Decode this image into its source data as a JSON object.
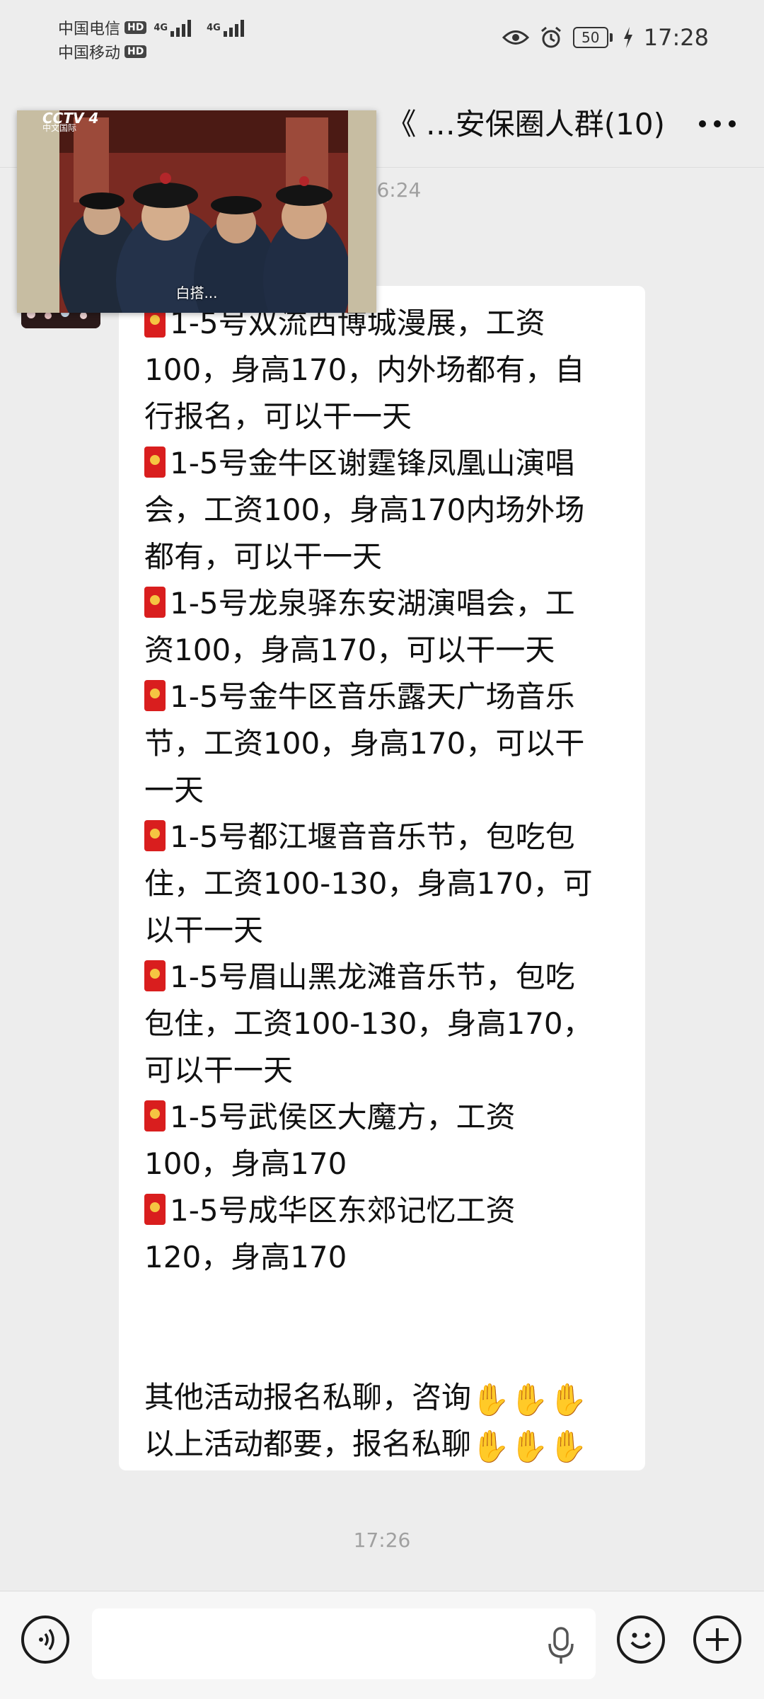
{
  "status_bar": {
    "carriers": [
      {
        "name": "中国电信",
        "badge": "HD",
        "network": "4G"
      },
      {
        "name": "中国移动",
        "badge": "HD",
        "network": "4G"
      }
    ],
    "battery": "50",
    "time": "17:28"
  },
  "header": {
    "title": "《 …安保圈人群(10)"
  },
  "floating_video": {
    "channel": "CCTV 4",
    "channel_sub": "中文国际",
    "subtitle": "白搭..."
  },
  "chat": {
    "timestamp_top": "16:24",
    "timestamp_bottom": "17:26",
    "message_lines": [
      {
        "text": "1-5号双流西博城漫展，工资",
        "redpacket": true
      },
      {
        "text": "100，身高170，内外场都有，自"
      },
      {
        "text": "行报名，可以干一天"
      },
      {
        "text": "1-5号金牛区谢霆锋凤凰山演唱",
        "redpacket": true
      },
      {
        "text": "会，工资100，身高170内场外场"
      },
      {
        "text": "都有，可以干一天"
      },
      {
        "text": "1-5号龙泉驿东安湖演唱会，工",
        "redpacket": true
      },
      {
        "text": "资100，身高170，可以干一天"
      },
      {
        "text": "1-5号金牛区音乐露天广场音乐",
        "redpacket": true
      },
      {
        "text": "节，工资100，身高170，可以干"
      },
      {
        "text": "一天"
      },
      {
        "text": "1-5号都江堰音音乐节，包吃包",
        "redpacket": true
      },
      {
        "text": "住，工资100-130，身高170，可"
      },
      {
        "text": "以干一天"
      },
      {
        "text": "1-5号眉山黑龙滩音乐节，包吃",
        "redpacket": true
      },
      {
        "text": "包住，工资100-130，身高170，"
      },
      {
        "text": "可以干一天"
      },
      {
        "text": "1-5号武侯区大魔方，工资",
        "redpacket": true
      },
      {
        "text": "100，身高170"
      },
      {
        "text": "1-5号成华区东郊记忆工资",
        "redpacket": true
      },
      {
        "text": "120，身高170"
      },
      {
        "text": ""
      },
      {
        "text": ""
      },
      {
        "text": "其他活动报名私聊，咨询",
        "emoji_count": 3
      },
      {
        "text": "以上活动都要，报名私聊",
        "emoji_count": 3
      }
    ]
  },
  "input_bar": {
    "placeholder": ""
  }
}
